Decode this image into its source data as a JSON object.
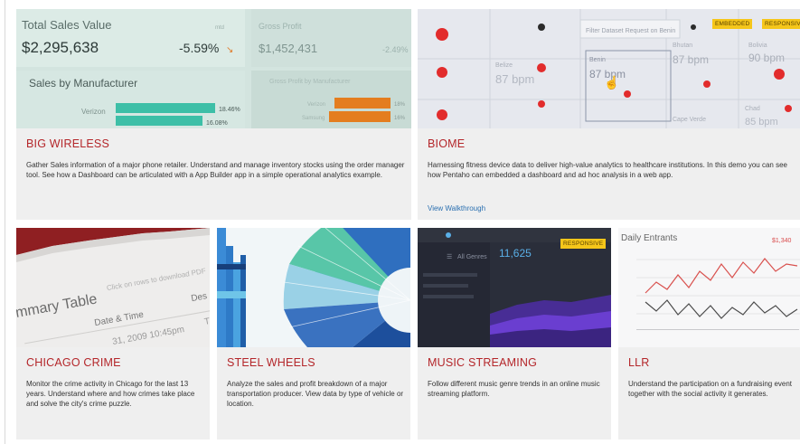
{
  "cards": [
    {
      "title": "BIG WIRELESS",
      "desc": "Gather Sales information of a major phone retailer. Understand and manage inventory stocks using the order manager tool. See how a Dashboard can be articulated with a App Builder app in a simple operational analytics example.",
      "thumb": {
        "total_label": "Total Sales Value",
        "total_value": "$2,295,638",
        "total_change": "-5.59%",
        "gp_label": "Gross Profit",
        "gp_value": "$1,452,431",
        "gp_change": "-2.49%",
        "section_title": "Sales by Manufacturer",
        "gp_section": "Gross Profit by Manufacturer",
        "bars": [
          {
            "label": "Verizon",
            "pct": "18.46%"
          },
          {
            "label": "",
            "pct": "16.08%"
          }
        ],
        "bars2": [
          {
            "label": "Verizon",
            "pct": "18%"
          },
          {
            "label": "Samsung",
            "pct": "16%"
          }
        ]
      }
    },
    {
      "title": "BIOME",
      "desc": "Harnessing fitness device data to deliver high-value analytics to healthcare institutions. In this demo you can see how Pentaho can embedded a dashboard and ad hoc analysis in a web app.",
      "link": "View Walkthrough",
      "badges": [
        "EMBEDDED",
        "RESPONSIVE"
      ],
      "thumb": {
        "filter_placeholder": "Filter Dataset Request on Benin",
        "cells": [
          {
            "country": "Belize",
            "value": "87 bpm"
          },
          {
            "country": "Benin",
            "value": "87 bpm"
          },
          {
            "country": "Bhutan",
            "value": "87 bpm"
          },
          {
            "country": "Bolivia",
            "value": "90 bpm"
          },
          {
            "country": "Cape Verde",
            "value": ""
          },
          {
            "country": "Chad",
            "value": "85 bpm"
          }
        ]
      }
    },
    {
      "title": "CHICAGO CRIME",
      "desc": "Monitor the crime activity in Chicago for the last 13 years. Understand where and how crimes take place and solve the city's crime puzzle.",
      "thumb": {
        "table_title": "mmary Table",
        "hint": "Click on rows to download PDF",
        "col1": "Date & Time",
        "col2": "Des",
        "row1": "31, 2009 10:45pm",
        "row1b": "TO"
      }
    },
    {
      "title": "STEEL WHEELS",
      "desc": "Analyze the sales and profit breakdown of a major transportation producer. View data by type of vehicle or location."
    },
    {
      "title": "MUSIC STREAMING",
      "desc": "Follow different music genre trends in an online music streaming platform.",
      "badges": [
        "RESPONSIVE"
      ],
      "thumb": {
        "menu_label": "All Genres",
        "big_number": "11,625"
      }
    },
    {
      "title": "LLR",
      "desc": "Understand the participation on a fundraising event together with the social activity it generates.",
      "thumb": {
        "chart_title": "Daily Entrants",
        "chart_value": "$1,340"
      }
    }
  ],
  "colors": {
    "title_red": "#b4262a",
    "badge_yellow": "#f5c61a",
    "link_blue": "#2a6fb0",
    "card_bg": "#efefef"
  }
}
